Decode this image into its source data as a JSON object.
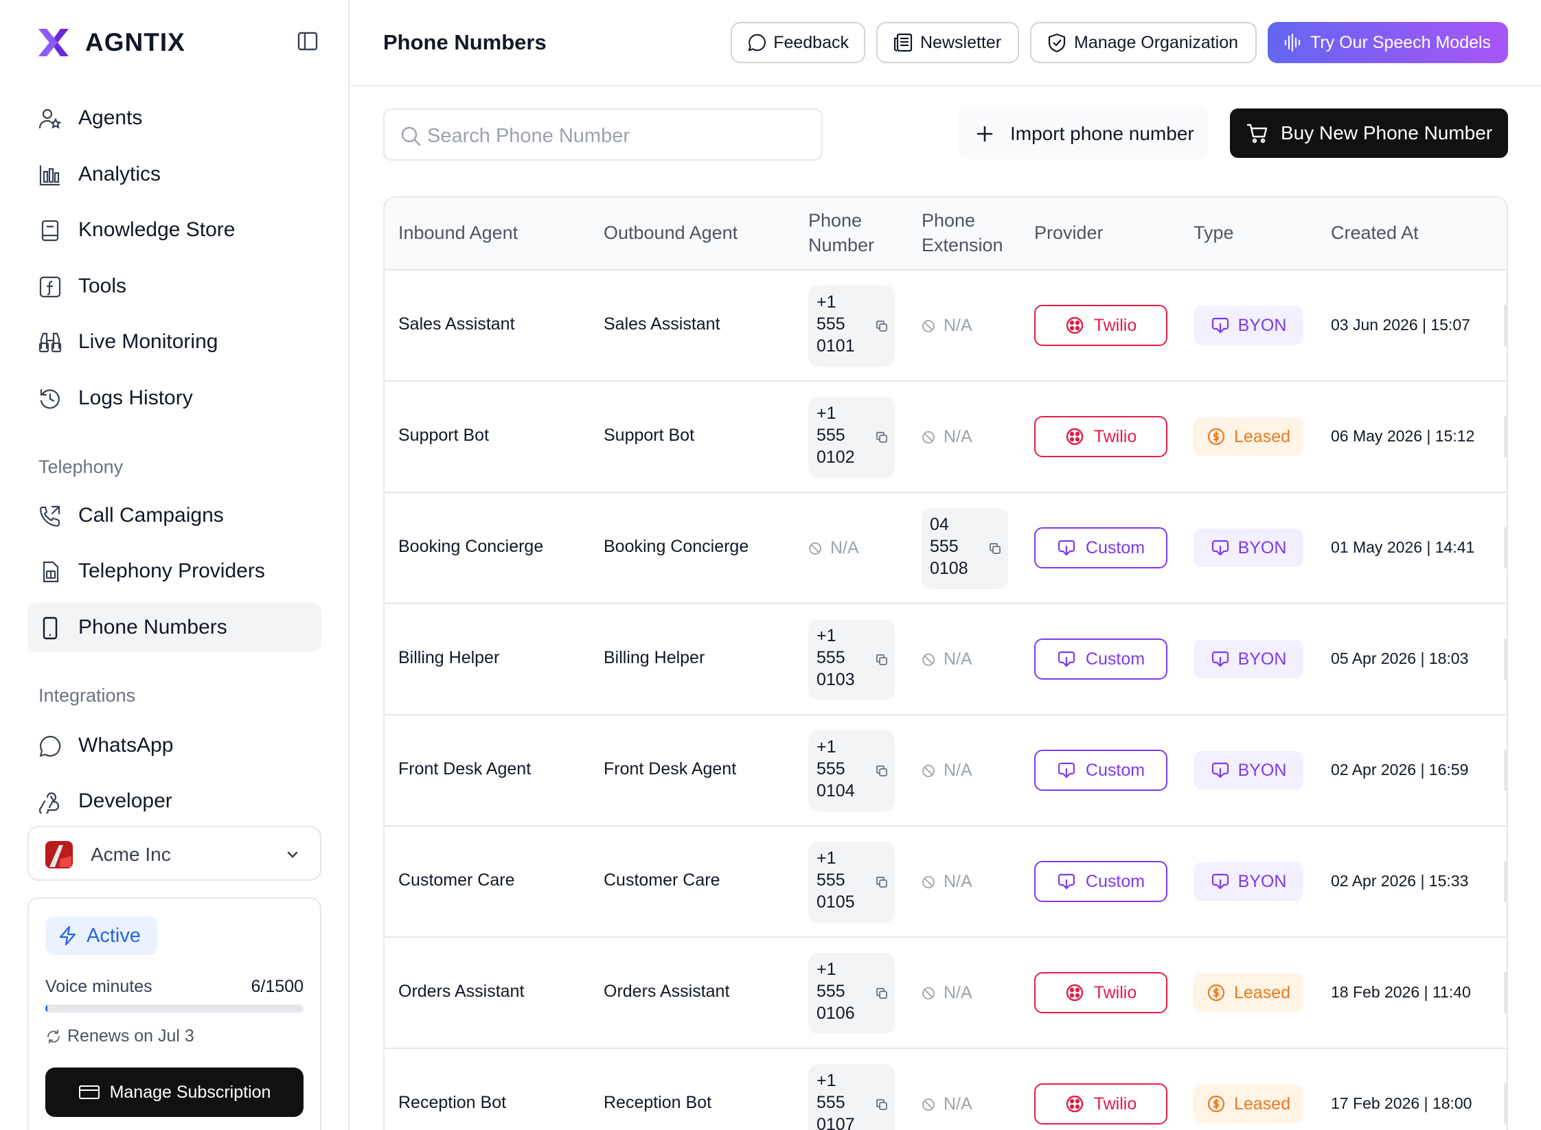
{
  "app": {
    "name": "AGNTIX"
  },
  "sidebar": {
    "nav": [
      {
        "id": "agents",
        "label": "Agents",
        "icon": "user-star-icon"
      },
      {
        "id": "analytics",
        "label": "Analytics",
        "icon": "bar-chart-icon"
      },
      {
        "id": "knowledge",
        "label": "Knowledge Store",
        "icon": "book-icon"
      },
      {
        "id": "tools",
        "label": "Tools",
        "icon": "function-icon"
      },
      {
        "id": "live",
        "label": "Live Monitoring",
        "icon": "binoculars-icon"
      },
      {
        "id": "logs",
        "label": "Logs History",
        "icon": "history-icon"
      }
    ],
    "telephony_label": "Telephony",
    "telephony": [
      {
        "id": "campaigns",
        "label": "Call Campaigns",
        "icon": "phone-outgoing-icon"
      },
      {
        "id": "providers",
        "label": "Telephony Providers",
        "icon": "sim-card-icon"
      },
      {
        "id": "numbers",
        "label": "Phone Numbers",
        "icon": "smartphone-icon",
        "active": true
      }
    ],
    "integrations_label": "Integrations",
    "integrations": [
      {
        "id": "whatsapp",
        "label": "WhatsApp",
        "icon": "chat-bubble-icon"
      },
      {
        "id": "developer",
        "label": "Developer",
        "icon": "webhook-icon"
      }
    ],
    "org": {
      "name": "Acme Inc"
    },
    "subscription": {
      "status": "Active",
      "voice_label": "Voice minutes",
      "voice_value": "6/1500",
      "voice_used": 6,
      "voice_total": 1500,
      "renews": "Renews on Jul 3",
      "manage_label": "Manage Subscription"
    }
  },
  "header": {
    "title": "Phone Numbers",
    "feedback": "Feedback",
    "newsletter": "Newsletter",
    "manage_org": "Manage Organization",
    "speech": "Try Our Speech Models"
  },
  "toolbar": {
    "search_placeholder": "Search Phone Number",
    "import_label": "Import phone number",
    "buy_label": "Buy New Phone Number"
  },
  "table": {
    "columns": {
      "inbound": "Inbound Agent",
      "outbound": "Outbound Agent",
      "phone": "Phone\nNumber",
      "extension": "Phone\nExtension",
      "provider": "Provider",
      "type": "Type",
      "created": "Created At"
    },
    "na_label": "N/A",
    "rows": [
      {
        "inbound": "Sales Assistant",
        "outbound": "Sales Assistant",
        "phone": "+1\n555\n0101",
        "extension": "",
        "provider": "Twilio",
        "type": "BYON",
        "created": "03 Jun 2026 | 15:07"
      },
      {
        "inbound": "Support Bot",
        "outbound": "Support Bot",
        "phone": "+1\n555\n0102",
        "extension": "",
        "provider": "Twilio",
        "type": "Leased",
        "created": "06 May 2026 | 15:12"
      },
      {
        "inbound": "Booking Concierge",
        "outbound": "Booking Concierge",
        "phone": "",
        "extension": "04\n555\n0108",
        "provider": "Custom",
        "type": "BYON",
        "created": "01 May 2026 | 14:41"
      },
      {
        "inbound": "Billing Helper",
        "outbound": "Billing Helper",
        "phone": "+1\n555\n0103",
        "extension": "",
        "provider": "Custom",
        "type": "BYON",
        "created": "05 Apr 2026 | 18:03"
      },
      {
        "inbound": "Front Desk Agent",
        "outbound": "Front Desk Agent",
        "phone": "+1\n555\n0104",
        "extension": "",
        "provider": "Custom",
        "type": "BYON",
        "created": "02 Apr 2026 | 16:59"
      },
      {
        "inbound": "Customer Care",
        "outbound": "Customer Care",
        "phone": "+1\n555\n0105",
        "extension": "",
        "provider": "Custom",
        "type": "BYON",
        "created": "02 Apr 2026 | 15:33"
      },
      {
        "inbound": "Orders Assistant",
        "outbound": "Orders Assistant",
        "phone": "+1\n555\n0106",
        "extension": "",
        "provider": "Twilio",
        "type": "Leased",
        "created": "18 Feb 2026 | 11:40"
      },
      {
        "inbound": "Reception Bot",
        "outbound": "Reception Bot",
        "phone": "+1\n555\n0107",
        "extension": "",
        "provider": "Twilio",
        "type": "Leased",
        "created": "17 Feb 2026 | 18:00"
      }
    ]
  },
  "colors": {
    "accent": "#7c3aed",
    "twilio": "#e11d48",
    "leased": "#ea7a1f",
    "active": "#2563eb",
    "primary_button": "#111111"
  }
}
